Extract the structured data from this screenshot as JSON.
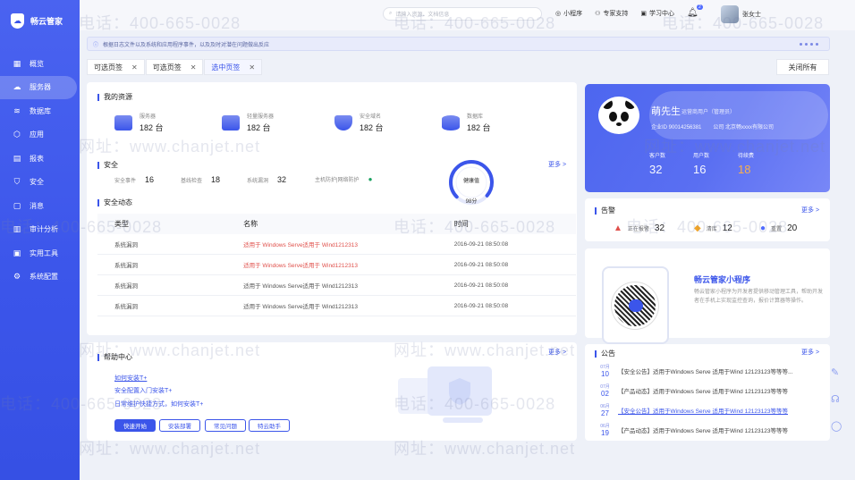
{
  "brand": {
    "name": "畅云管家"
  },
  "nav": [
    {
      "label": "概览",
      "icon": "grid-icon"
    },
    {
      "label": "服务器",
      "icon": "cloud-icon",
      "active": true
    },
    {
      "label": "数据库",
      "icon": "database-icon"
    },
    {
      "label": "应用",
      "icon": "cube-icon"
    },
    {
      "label": "报表",
      "icon": "chart-icon"
    },
    {
      "label": "安全",
      "icon": "shield-icon"
    },
    {
      "label": "消息",
      "icon": "message-icon"
    },
    {
      "label": "审计分析",
      "icon": "bar-chart-icon"
    },
    {
      "label": "实用工具",
      "icon": "toolbox-icon"
    },
    {
      "label": "系统配置",
      "icon": "gear-icon"
    }
  ],
  "topbar": {
    "search_placeholder": "请输入资源、文档信息",
    "links": [
      "小程序",
      "专家支持",
      "学习中心"
    ],
    "bell_count": "2",
    "user_name": "张女士"
  },
  "notice": {
    "text": "根据日志文件以及系统和应用程序事件，以及及时对潜在问题做出反应"
  },
  "tabs": [
    {
      "label": "可选页签",
      "active": false
    },
    {
      "label": "可选页签",
      "active": false
    },
    {
      "label": "选中页签",
      "active": true
    }
  ],
  "close_all": "关闭所有",
  "resources": {
    "title": "我的资源",
    "items": [
      {
        "label": "服务器",
        "value": "182 台"
      },
      {
        "label": "轻量服务器",
        "value": "182 台"
      },
      {
        "label": "安全域名",
        "value": "182 台"
      },
      {
        "label": "数据库",
        "value": "182 台"
      }
    ]
  },
  "security": {
    "title": "安全",
    "more": "更多 >",
    "stats": [
      {
        "label": "安全事件",
        "value": "16"
      },
      {
        "label": "基线检查",
        "value": "18"
      },
      {
        "label": "系统漏洞",
        "value": "32"
      },
      {
        "label": "主机防护|网络防护",
        "value": ""
      }
    ],
    "health_label": "健康值",
    "health_score": "98分",
    "health_fraction": 0.98
  },
  "dynamics": {
    "title": "安全动态",
    "headers": [
      "类型",
      "名称",
      "时间"
    ],
    "rows": [
      {
        "type": "系统漏洞",
        "name": "适用于 Windows Serve适用于 Wind1212313",
        "time": "2016-09-21  08:50:08",
        "highlight": true
      },
      {
        "type": "系统漏洞",
        "name": "适用于 Windows Serve适用于 Wind1212313",
        "time": "2016-09-21  08:50:08",
        "highlight": true
      },
      {
        "type": "系统漏洞",
        "name": "适用于 Windows Serve适用于 Wind1212313",
        "time": "2016-09-21  08:50:08",
        "highlight": false
      },
      {
        "type": "系统漏洞",
        "name": "适用于 Windows Serve适用于 Wind1212313",
        "time": "2016-09-21  08:50:08",
        "highlight": false
      }
    ]
  },
  "help": {
    "title": "帮助中心",
    "more": "更多 >",
    "links": [
      "如何安装T+",
      "安全配置入门安装T+",
      "日常维护快捷方式，如何安装T+"
    ],
    "buttons": [
      "快速开始",
      "安装部署",
      "常见问题",
      "特云助手"
    ]
  },
  "profile": {
    "name": "萌先生",
    "role": "运营商用户（管理员）",
    "enterprise_id": "企业ID  9001425638​1",
    "company": "公司  北京畅xxxx有限公司",
    "stats": [
      {
        "label": "客户数",
        "value": "32"
      },
      {
        "label": "用户数",
        "value": "16"
      },
      {
        "label": "待续费",
        "value": "18"
      }
    ]
  },
  "alerts": {
    "title": "告警",
    "more": "更多 >",
    "items": [
      {
        "label": "正在报警",
        "value": "32",
        "color": "#e0504b"
      },
      {
        "label": "清库",
        "value": "12",
        "color": "#f5a623"
      },
      {
        "label": "重置",
        "value": "20",
        "color": "#4f6bff"
      }
    ]
  },
  "miniapp": {
    "title": "畅云管家小程序",
    "desc": "畅云管家小程序为开发者提供移动管理工具，帮助开发者在手机上实现监控查询，报价计算器等操作。"
  },
  "announcements": {
    "title": "公告",
    "more": "更多 >",
    "items": [
      {
        "month": "07月",
        "day": "10",
        "text": "【安全公告】适用于Windows Serve 适用于Wind 12123123等等等..."
      },
      {
        "month": "07月",
        "day": "02",
        "text": "【产品动态】适用于Windows Serve 适用于Wind 12123123等等等"
      },
      {
        "month": "06月",
        "day": "27",
        "text": "【安全公告】适用于Windows Serve 适用于Wind 12123123等等等",
        "link": true
      },
      {
        "month": "06月",
        "day": "19",
        "text": "【产品动态】适用于Windows Serve 适用于Wind 12123123等等等"
      }
    ]
  },
  "watermark": {
    "phone": "电话：400-665-0028",
    "site": "网址：www.chanjet.net"
  },
  "colors": {
    "primary": "#3b55ea",
    "danger": "#e0504b",
    "warn": "#ffb347"
  }
}
